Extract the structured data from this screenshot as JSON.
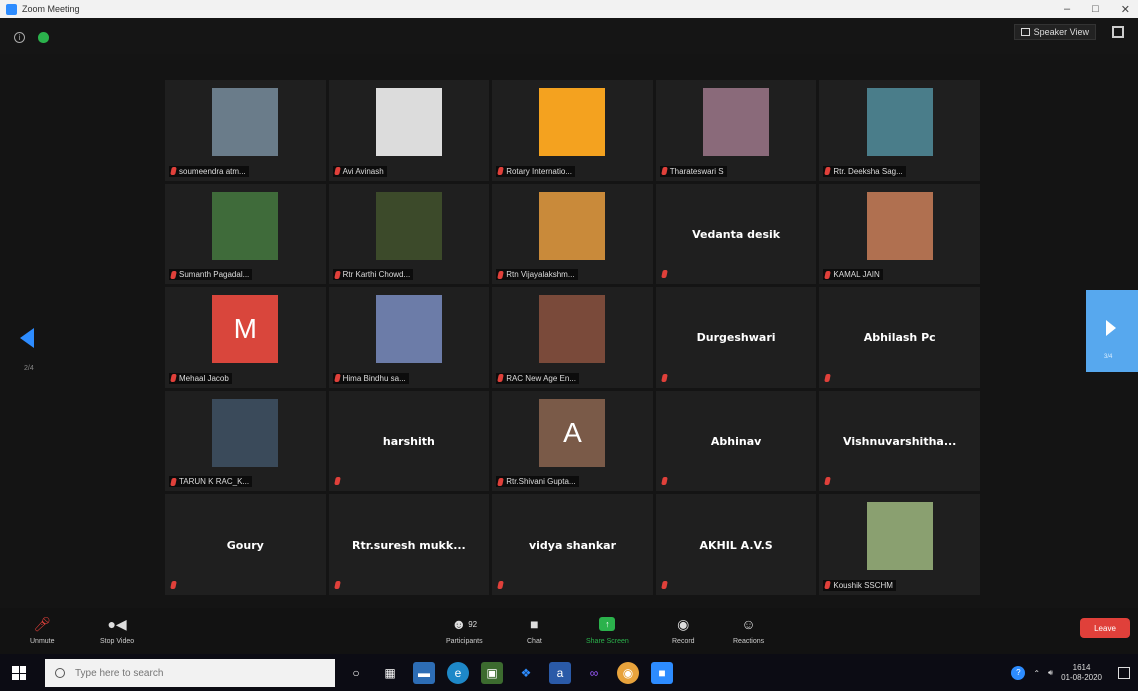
{
  "window": {
    "title": "Zoom Meeting"
  },
  "topbar": {
    "speaker_view_label": "Speaker View"
  },
  "grid": {
    "page_left_indicator": "2/4",
    "page_right_indicator": "3/4",
    "tiles": [
      {
        "name": "soumeendra atm...",
        "type": "photo",
        "color": "#6a7c8a"
      },
      {
        "name": "Avi Avinash",
        "type": "photo",
        "color": "#dcdcdc"
      },
      {
        "name": "Rotary Internatio...",
        "type": "photo",
        "color": "#f4a21f"
      },
      {
        "name": "Tharateswari S",
        "type": "photo",
        "color": "#8a6a7a"
      },
      {
        "name": "Rtr. Deeksha Sag...",
        "type": "photo",
        "color": "#4a7d8a"
      },
      {
        "name": "Sumanth Pagadal...",
        "type": "photo",
        "color": "#3f6b3a"
      },
      {
        "name": "Rtr Karthi Chowd...",
        "type": "photo",
        "color": "#3c4a2a"
      },
      {
        "name": "Rtn Vijayalakshm...",
        "type": "photo",
        "color": "#c98a3a"
      },
      {
        "name": "Vedanta desik",
        "type": "text"
      },
      {
        "name": "KAMAL JAIN",
        "type": "photo",
        "color": "#b07050"
      },
      {
        "name": "Mehaal Jacob",
        "type": "letter",
        "letter": "M",
        "color": "#d9463c"
      },
      {
        "name": "Hima Bindhu sa...",
        "type": "photo",
        "color": "#6c7ca8"
      },
      {
        "name": "RAC New Age En...",
        "type": "photo",
        "color": "#7a4a3a"
      },
      {
        "name": "Durgeshwari",
        "type": "text"
      },
      {
        "name": "Abhilash Pc",
        "type": "text"
      },
      {
        "name": "TARUN K RAC_K...",
        "type": "photo",
        "color": "#3a4a5a"
      },
      {
        "name": "harshith",
        "type": "text"
      },
      {
        "name": "Rtr.Shivani Gupta...",
        "type": "letter",
        "letter": "A",
        "color": "#7a5a48"
      },
      {
        "name": "Abhinav",
        "type": "text"
      },
      {
        "name": "Vishnuvarshitha...",
        "type": "text"
      },
      {
        "name": "Goury",
        "type": "text"
      },
      {
        "name": "Rtr.suresh mukk...",
        "type": "text"
      },
      {
        "name": "vidya shankar",
        "type": "text"
      },
      {
        "name": "AKHIL A.V.S",
        "type": "text"
      },
      {
        "name": "Koushik SSCHM",
        "type": "photo",
        "color": "#8aa070"
      }
    ]
  },
  "controls": {
    "unmute_label": "Unmute",
    "stop_video_label": "Stop Video",
    "participants_label": "Participants",
    "participants_count": "92",
    "chat_label": "Chat",
    "share_screen_label": "Share Screen",
    "record_label": "Record",
    "reactions_label": "Reactions",
    "leave_label": "Leave"
  },
  "taskbar": {
    "search_placeholder": "Type here to search",
    "time": "1614",
    "date": "01-08-2020"
  }
}
